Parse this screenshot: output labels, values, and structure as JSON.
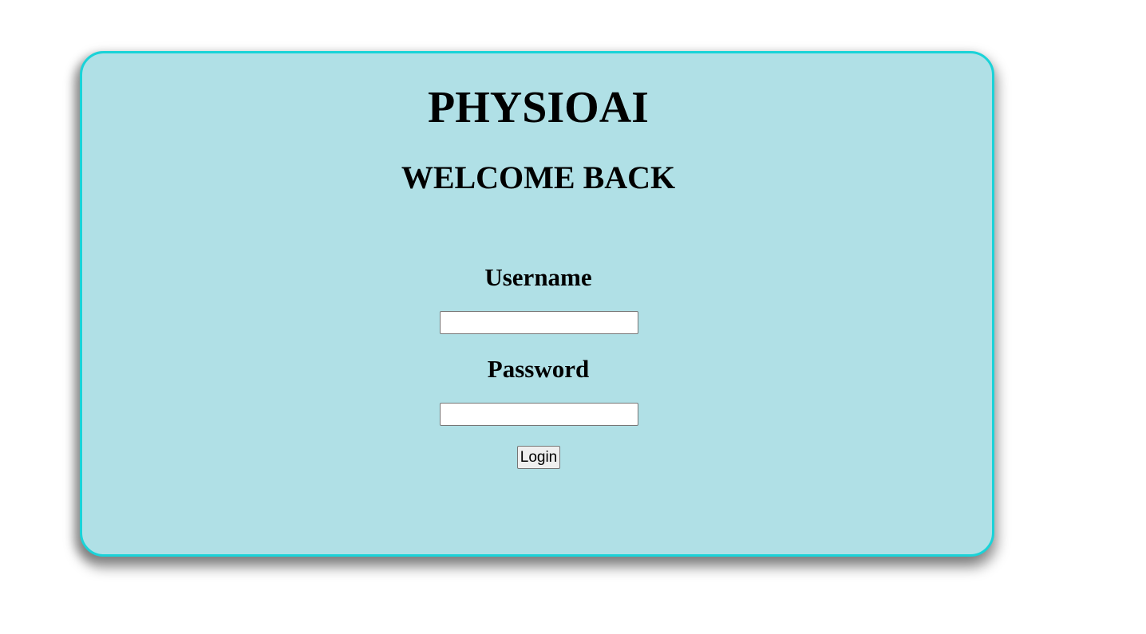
{
  "brand": {
    "title": "PHYSIOAI",
    "subtitle": "WELCOME BACK"
  },
  "form": {
    "username_label": "Username",
    "username_value": "",
    "password_label": "Password",
    "password_value": "",
    "login_label": "Login"
  },
  "colors": {
    "card_background": "#b0e0e6",
    "card_border": "#1ad3d8",
    "page_background": "#ffffff"
  }
}
